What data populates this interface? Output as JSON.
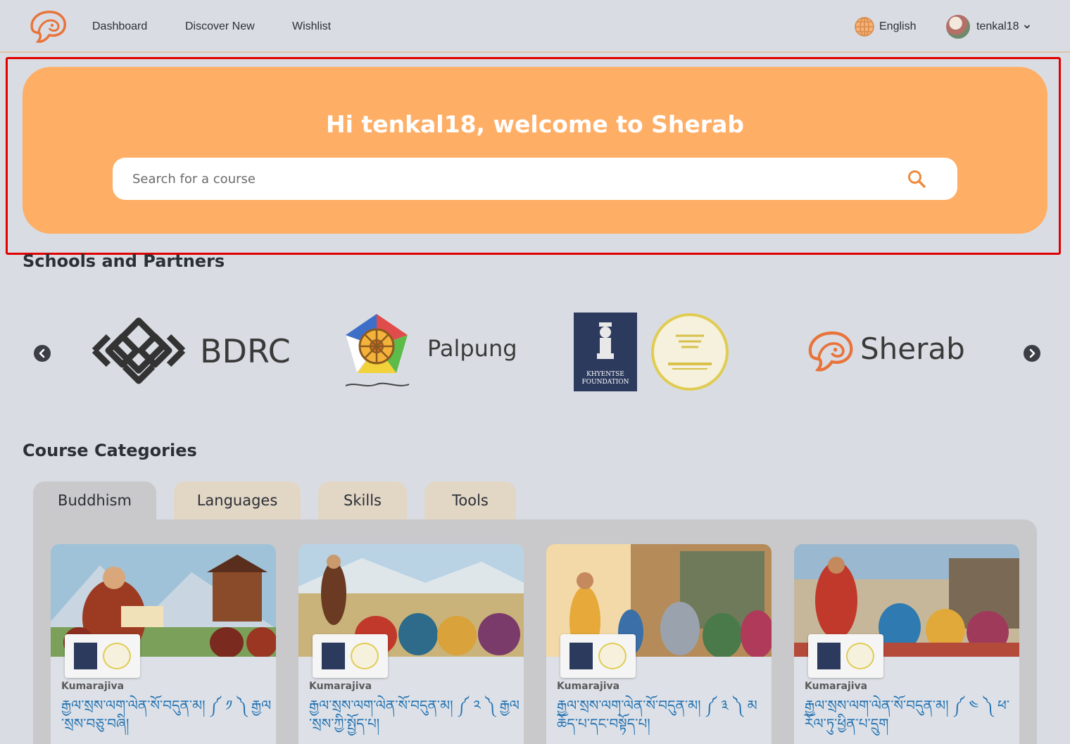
{
  "nav": {
    "logo": "sherab-logo",
    "links": [
      "Dashboard",
      "Discover New",
      "Wishlist"
    ],
    "language": "English",
    "username": "tenkal18"
  },
  "hero": {
    "title": "Hi tenkal18, welcome to Sherab",
    "search_placeholder": "Search for a course"
  },
  "partners": {
    "title": "Schools and Partners",
    "items": [
      {
        "name": "BDRC",
        "icon": "endless-knot-logo"
      },
      {
        "name": "Palpung",
        "icon": "dharma-wheel-logo"
      },
      {
        "name": "Khyentse Foundation",
        "line1": "KHYENTSE",
        "line2": "FOUNDATION",
        "icon": "kumarajiva-project-logo"
      },
      {
        "name": "Sherab",
        "icon": "sherab-logo"
      }
    ]
  },
  "categories": {
    "title": "Course Categories",
    "tabs": [
      "Buddhism",
      "Languages",
      "Skills",
      "Tools"
    ],
    "active_tab": "Buddhism",
    "courses": [
      {
        "partner": "Kumarajiva",
        "title": "རྒྱལ་སྲས་ལག་ལེན་སོ་བདུན་མ། ༼ ༡ ༽ རྒྱལ་སྲས་བཅུ་བཞི།"
      },
      {
        "partner": "Kumarajiva",
        "title": "རྒྱལ་སྲས་ལག་ལེན་སོ་བདུན་མ། ༼ ༢ ༽ རྒྱལ་སྲས་ཀྱི་སྤྱོད་པ།"
      },
      {
        "partner": "Kumarajiva",
        "title": "རྒྱལ་སྲས་ལག་ལེན་སོ་བདུན་མ། ༼ ༣ ༽ མཆོད་པ་དང་བསྟོད་པ།"
      },
      {
        "partner": "Kumarajiva",
        "title": "རྒྱལ་སྲས་ལག་ལེན་སོ་བདུན་མ། ༼ ༤ ༽ ཕ་རོལ་ཏུ་ཕྱིན་པ་དྲུག"
      }
    ]
  },
  "colors": {
    "accent": "#ffae66",
    "background": "#d9dde3",
    "highlight": "#e00000",
    "course_title": "#1f6fb0"
  }
}
